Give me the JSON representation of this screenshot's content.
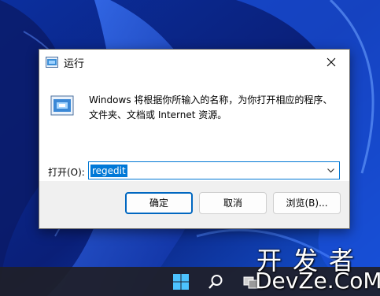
{
  "dialog": {
    "title": "运行",
    "description": "Windows 将根据你所输入的名称，为你打开相应的程序、文件夹、文档或 Internet 资源。",
    "open_label": "打开(O):",
    "input_value": "regedit",
    "buttons": {
      "ok": "确定",
      "cancel": "取消",
      "browse": "浏览(B)..."
    }
  },
  "watermark": {
    "cn": "开发者",
    "en": "DevZe.CoM"
  },
  "colors": {
    "accent": "#0078d4",
    "wallpaper": "#0a2a8c"
  },
  "icons": [
    "run-icon",
    "close-icon",
    "chevron-down-icon",
    "windows-start-icon",
    "search-icon",
    "task-view-icon"
  ]
}
